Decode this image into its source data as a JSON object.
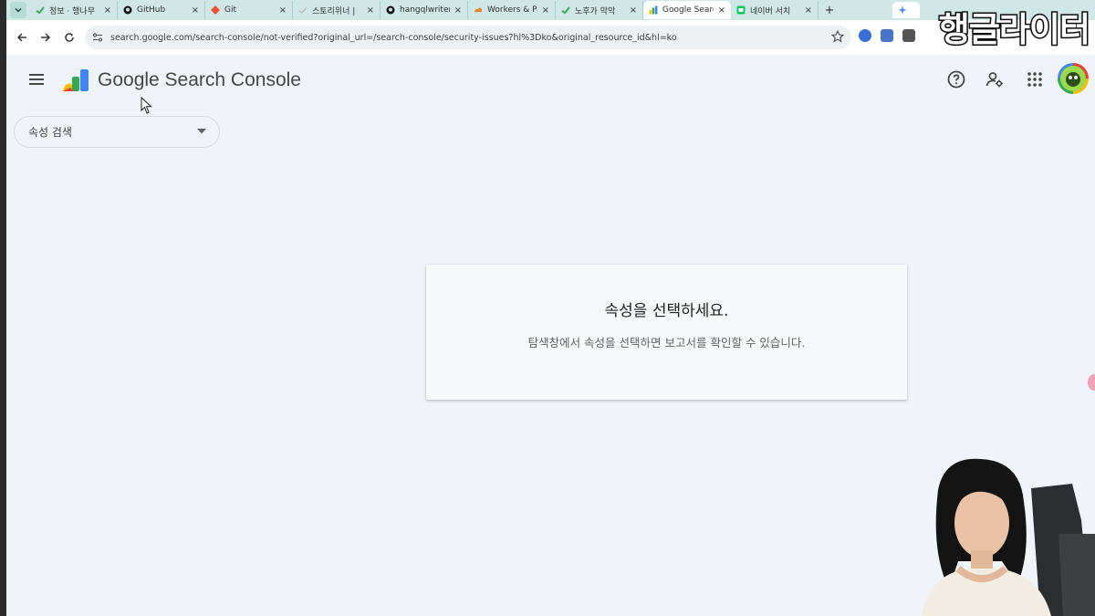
{
  "browser": {
    "tabs": [
      {
        "title": "정보 · 행나무",
        "favicon": "green-check-icon"
      },
      {
        "title": "GitHub",
        "favicon": "github-icon"
      },
      {
        "title": "Git",
        "favicon": "git-icon"
      },
      {
        "title": "스토리위너 |",
        "favicon": "generic-page-icon"
      },
      {
        "title": "hangqlwriter",
        "favicon": "github-icon"
      },
      {
        "title": "Workers & Pa",
        "favicon": "cloudflare-icon"
      },
      {
        "title": "노후가 막막",
        "favicon": "green-check-icon"
      },
      {
        "title": "Google Searc",
        "favicon": "search-console-icon",
        "active": true
      },
      {
        "title": "네이버 서치",
        "favicon": "naver-icon"
      }
    ],
    "new_tab_symbol": "+",
    "tab_close_symbol": "×",
    "url": "search.google.com/search-console/not-verified?original_url=/search-console/security-issues?hl%3Dko&original_resource_id&hl=ko"
  },
  "watermark": "행글라이터",
  "app": {
    "product_name": "Google Search Console",
    "property_search_label": "속성 검색"
  },
  "empty_state": {
    "title": "속성을 선택하세요.",
    "body": "탐색창에서 속성을 선택하면 보고서를 확인할 수 있습니다."
  },
  "colors": {
    "page_background": "#f0f4f9",
    "tab_strip": "#cfe8e6",
    "card_background": "#f8f9fa"
  }
}
